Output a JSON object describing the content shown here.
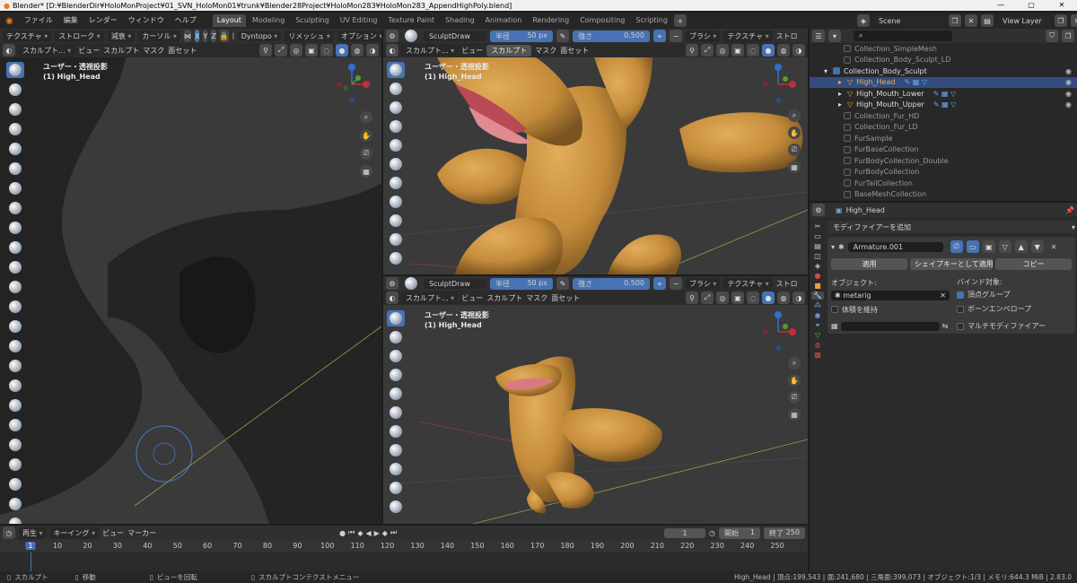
{
  "window": {
    "title": "Blender* [D:¥BlenderDir¥HoloMonProject¥01_SVN_HoloMon01¥trunk¥Blender28Project¥HoloMon283¥HoloMon283_AppendHighPoly.blend]",
    "minimize": "—",
    "maximize": "▢",
    "close": "✕"
  },
  "menu": {
    "items": [
      "ファイル",
      "編集",
      "レンダー",
      "ウィンドウ",
      "ヘルプ"
    ]
  },
  "workspaces": [
    "Layout",
    "Modeling",
    "Sculpting",
    "UV Editing",
    "Texture Paint",
    "Shading",
    "Animation",
    "Rendering",
    "Compositing",
    "Scripting"
  ],
  "workspace_add": "+",
  "scene": {
    "name": "Scene",
    "view_layer": "View Layer"
  },
  "left_view": {
    "header": {
      "texture": "テクスチャ",
      "stroke": "ストローク",
      "falloff": "減衰",
      "cursor": "カーソル",
      "x": "X",
      "y": "Y",
      "z": "Z",
      "dyntopo": "Dyntopo",
      "remesh": "リメッシュ",
      "options": "オプション"
    },
    "header2": {
      "mode": "スカルプト...",
      "view": "ビュー",
      "sculpt": "スカルプト",
      "mask": "マスク",
      "face_set": "面セット"
    },
    "overlay": {
      "view_name": "ユーザー・透視投影",
      "object": "(1) High_Head"
    }
  },
  "top_right_view": {
    "toolbar": {
      "brush": "SculptDraw",
      "radius_label": "半径",
      "radius_value": "50 px",
      "strength_label": "強さ",
      "strength_value": "0.500",
      "brush_menu": "ブラシ",
      "texture_menu": "テクスチャ",
      "stroke_menu": "ストロ"
    },
    "header2": {
      "mode": "スカルプト...",
      "view": "ビュー",
      "sculpt": "スカルプト",
      "mask": "マスク",
      "face_set": "面セット"
    },
    "overlay": {
      "view_name": "ユーザー・透視投影",
      "object": "(1) High_Head"
    }
  },
  "bottom_right_view": {
    "toolbar": {
      "brush": "SculptDraw",
      "radius_label": "半径",
      "radius_value": "50 px",
      "strength_label": "強さ",
      "strength_value": "0.500",
      "brush_menu": "ブラシ",
      "texture_menu": "テクスチャ",
      "stroke_menu": "ストロ"
    },
    "header2": {
      "mode": "スカルプト...",
      "view": "ビュー",
      "sculpt": "スカルプト",
      "mask": "マスク",
      "face_set": "面セット"
    },
    "overlay": {
      "view_name": "ユーザー・透視投影",
      "object": "(1) High_Head"
    }
  },
  "gizmo": {
    "z": "Z",
    "y": "Y",
    "x": "X"
  },
  "outliner": {
    "items": [
      {
        "name": "Collection_SimpleMesh",
        "checked": false,
        "selected": false
      },
      {
        "name": "Collection_Body_Sculpt_LD",
        "checked": false,
        "selected": false
      },
      {
        "name": "Collection_Body_Sculpt",
        "checked": true,
        "selected": false
      },
      {
        "name": "High_Head",
        "checked": false,
        "selected": true
      },
      {
        "name": "High_Mouth_Lower",
        "checked": false,
        "selected": false
      },
      {
        "name": "High_Mouth_Upper",
        "checked": false,
        "selected": false
      },
      {
        "name": "Collection_Fur_HD",
        "checked": false,
        "selected": false
      },
      {
        "name": "Collection_Fur_LD",
        "checked": false,
        "selected": false
      },
      {
        "name": "FurSample",
        "checked": false,
        "selected": false
      },
      {
        "name": "FurBaseCollection",
        "checked": false,
        "selected": false
      },
      {
        "name": "FurBodyCollection_Double",
        "checked": false,
        "selected": false
      },
      {
        "name": "FurBodyCollection",
        "checked": false,
        "selected": false
      },
      {
        "name": "FurTailCollection",
        "checked": false,
        "selected": false
      },
      {
        "name": "BaseMeshCollection",
        "checked": false,
        "selected": false
      }
    ]
  },
  "properties": {
    "object_name": "High_Head",
    "add_modifier": "モディファイアーを追加",
    "modifier_name": "Armature.001",
    "apply": "適用",
    "apply_as_shapekey": "シェイプキーとして適用",
    "copy": "コピー",
    "object_label": "オブジェクト:",
    "object_value": "metarig",
    "bind_label": "バインド対象:",
    "vertex_groups": "頂点グループ",
    "bone_envelopes": "ボーンエンベロープ",
    "preserve_volume": "体積を維持",
    "multi_modifier": "マルチモディファイアー"
  },
  "timeline": {
    "playback": "再生",
    "keying": "キーイング",
    "view": "ビュー",
    "marker": "マーカー",
    "current_frame": "1",
    "start_label": "開始",
    "start_value": "1",
    "end_label": "終了",
    "end_value": "250",
    "ticks": [
      "1",
      "10",
      "20",
      "30",
      "40",
      "50",
      "60",
      "70",
      "80",
      "90",
      "100",
      "110",
      "120",
      "130",
      "140",
      "150",
      "160",
      "170",
      "180",
      "190",
      "200",
      "210",
      "220",
      "230",
      "240",
      "250"
    ]
  },
  "statusbar": {
    "sculpt": "スカルプト",
    "move": "移動",
    "rotate_view": "ビューを回転",
    "context_menu": "スカルプトコンテクストメニュー",
    "stats": "High_Head | 頂点:199,543 | 面:241,680 | 三角面:399,073 | オブジェクト:1/3 | メモリ:644.3 MiB | 2.83.0"
  }
}
